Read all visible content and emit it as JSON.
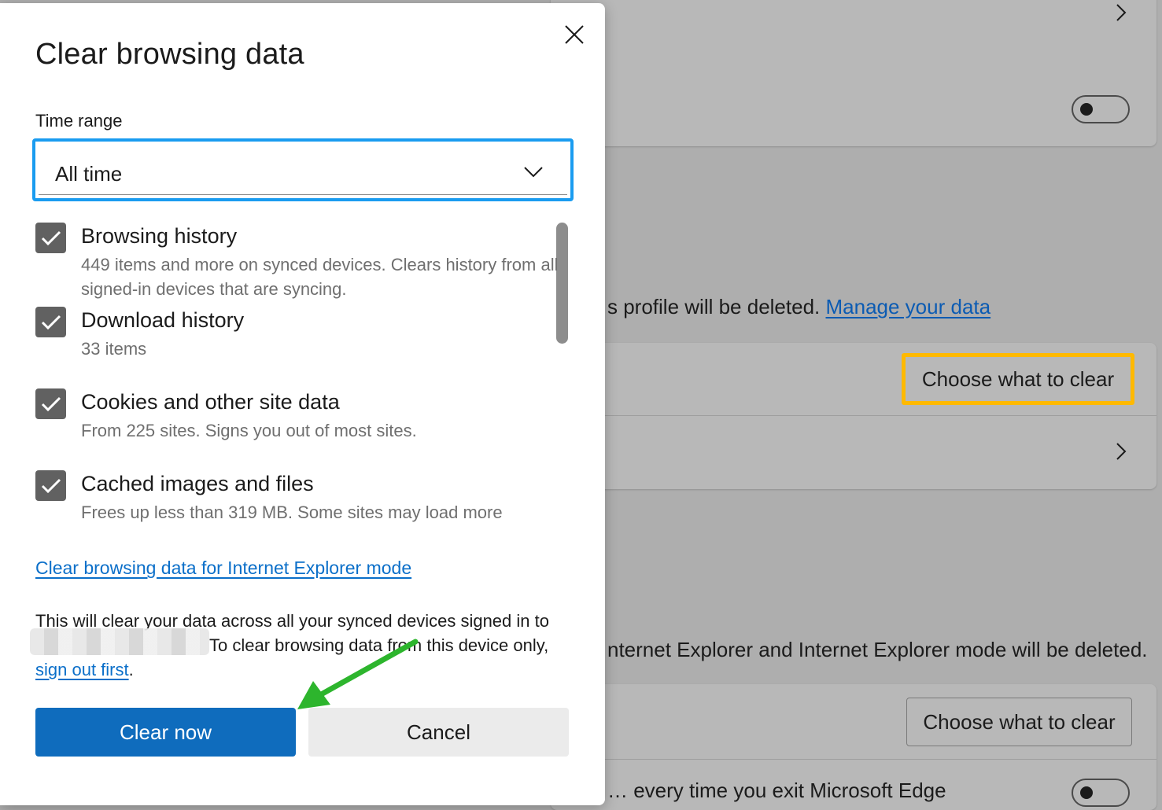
{
  "dialog": {
    "title": "Clear browsing data",
    "time_range_label": "Time range",
    "time_range_value": "All time",
    "items": [
      {
        "title": "Browsing history",
        "desc": "449 items and more on synced devices. Clears history from all signed-in devices that are syncing.",
        "checked": true
      },
      {
        "title": "Download history",
        "desc": "33 items",
        "checked": true
      },
      {
        "title": "Cookies and other site data",
        "desc": "From 225 sites. Signs you out of most sites.",
        "checked": true
      },
      {
        "title": "Cached images and files",
        "desc": "Frees up less than 319 MB. Some sites may load more",
        "checked": true
      }
    ],
    "ie_link": "Clear browsing data for Internet Explorer mode",
    "notice_line1": "This will clear your data across all your synced devices signed in to",
    "notice_line2": "To clear browsing data from this device only,",
    "signout_link": "sign out first",
    "notice_end": ".",
    "clear_button": "Clear now",
    "cancel_button": "Cancel"
  },
  "background": {
    "profile_text": "s profile will be deleted.",
    "manage_link": "Manage your data",
    "choose_button_1": "Choose what to clear",
    "ie_text": "nternet Explorer and Internet Explorer mode will be deleted.",
    "choose_button_2": "Choose what to clear",
    "bottom_partial": "… every time you exit Microsoft Edge"
  },
  "colors": {
    "accent": "#0f6cbd",
    "highlight": "#ffb900",
    "annotation_arrow": "#2db52d"
  }
}
